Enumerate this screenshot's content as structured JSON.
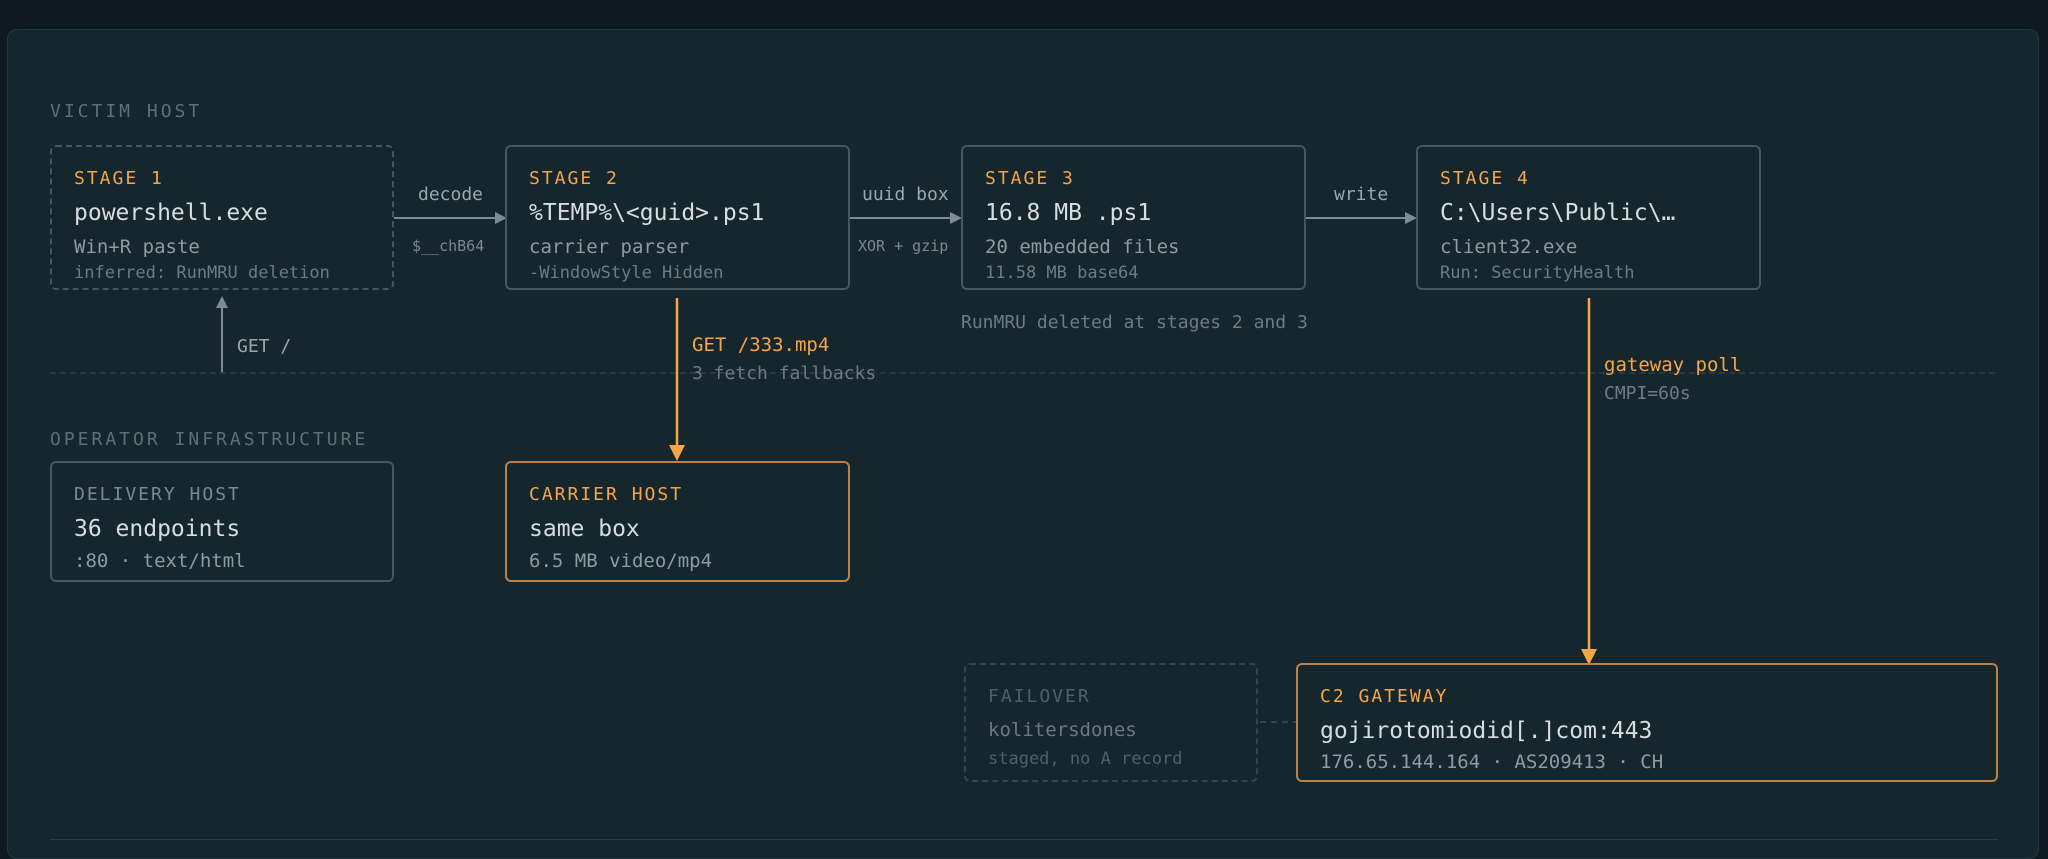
{
  "sections": {
    "victim": "VICTIM HOST",
    "operator": "OPERATOR INFRASTRUCTURE"
  },
  "stages": [
    {
      "title": "STAGE 1",
      "main": "powershell.exe",
      "sub1": "Win+R paste",
      "sub2": "inferred: RunMRU deletion"
    },
    {
      "title": "STAGE 2",
      "main": "%TEMP%\\<guid>.ps1",
      "sub1": "carrier parser",
      "sub2": "-WindowStyle Hidden"
    },
    {
      "title": "STAGE 3",
      "main": "16.8 MB .ps1",
      "sub1": "20 embedded files",
      "sub2": "11.58 MB base64"
    },
    {
      "title": "STAGE 4",
      "main": "C:\\Users\\Public\\…",
      "sub1": "client32.exe",
      "sub2": "Run: SecurityHealth"
    }
  ],
  "edges": {
    "decode": {
      "label": "decode",
      "sub": "$__chB64"
    },
    "uuid_box": {
      "label": "uuid box",
      "sub": "XOR + gzip"
    },
    "write": {
      "label": "write"
    },
    "get_root": {
      "label": "GET /"
    },
    "get_mp4": {
      "label": "GET /333.mp4",
      "sub": "3 fetch fallbacks"
    },
    "gateway_poll": {
      "label": "gateway poll",
      "sub": "CMPI=60s"
    }
  },
  "note_runmru": "RunMRU deleted at stages 2 and 3",
  "delivery_host": {
    "title": "DELIVERY HOST",
    "main": "36 endpoints",
    "sub": ":80 · text/html"
  },
  "carrier_host": {
    "title": "CARRIER HOST",
    "main": "same box",
    "sub": "6.5 MB video/mp4"
  },
  "failover": {
    "title": "FAILOVER",
    "main": "kolitersdones",
    "sub": "staged, no A record"
  },
  "c2_gateway": {
    "title": "C2 GATEWAY",
    "main": "gojirotomiodid[.]com:443",
    "sub": "176.65.144.164 · AS209413 · CH"
  },
  "colors": {
    "accent": "#f5a54a",
    "border": "#45585f",
    "background": "#16262d"
  }
}
